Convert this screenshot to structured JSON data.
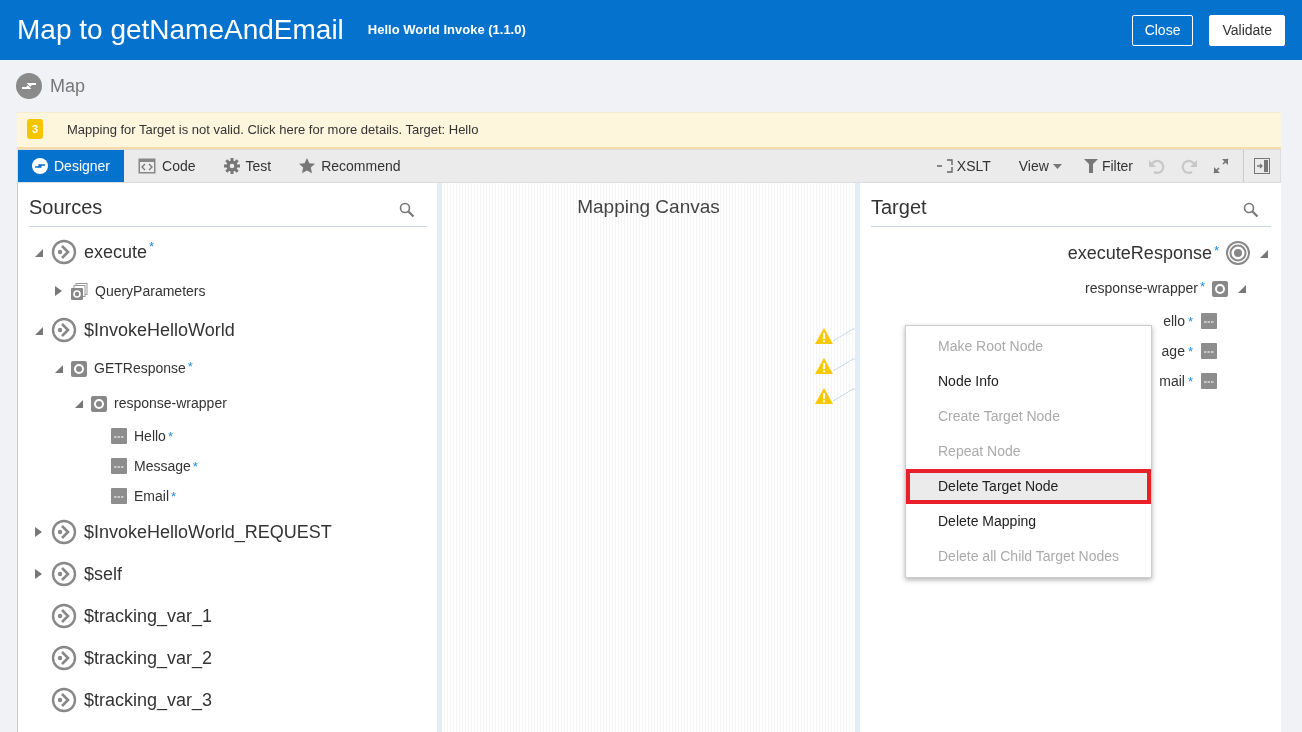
{
  "header": {
    "title": "Map to getNameAndEmail",
    "subtitle": "Hello World Invoke (1.1.0)",
    "buttons": [
      {
        "label": "Close",
        "kind": "outline"
      },
      {
        "label": "Validate",
        "kind": "solid"
      }
    ]
  },
  "page_title": "Map",
  "alert": {
    "count": "3",
    "message": "Mapping for Target is not valid. Click here for more details. Target: Hello"
  },
  "tabs": [
    {
      "label": "Designer",
      "kind": "designer",
      "selected": true
    },
    {
      "label": "Code",
      "kind": "code",
      "selected": false
    },
    {
      "label": "Test",
      "kind": "test",
      "selected": false
    },
    {
      "label": "Recommend",
      "kind": "recommend",
      "selected": false
    }
  ],
  "tools": [
    {
      "kind": "xslt",
      "label": "XSLT",
      "disabled": false
    },
    {
      "kind": "view",
      "label": "View",
      "disabled": false
    },
    {
      "kind": "filter",
      "label": "Filter",
      "disabled": false
    },
    {
      "kind": "undo",
      "disabled": true
    },
    {
      "kind": "redo",
      "disabled": true
    },
    {
      "kind": "expand",
      "disabled": false
    },
    {
      "kind": "panel",
      "disabled": false
    }
  ],
  "sources": {
    "title": "Sources",
    "tree": [
      {
        "label": "execute",
        "kind": "variable",
        "required_mark": "*",
        "expanded": true,
        "children": [
          {
            "label": "QueryParameters",
            "kind": "collection",
            "expanded": false
          }
        ]
      },
      {
        "label": "$InvokeHelloWorld",
        "kind": "variable",
        "expanded": true,
        "children": [
          {
            "label": "GETResponse",
            "kind": "element",
            "required_mark": "*",
            "expanded": true,
            "children": [
              {
                "label": "response-wrapper",
                "kind": "element",
                "expanded": true,
                "children": [
                  {
                    "label": "Hello",
                    "kind": "text",
                    "required_mark": "*"
                  },
                  {
                    "label": "Message",
                    "kind": "text",
                    "required_mark": "*"
                  },
                  {
                    "label": "Email",
                    "kind": "text",
                    "required_mark": "*"
                  }
                ]
              }
            ]
          }
        ]
      },
      {
        "label": "$InvokeHelloWorld_REQUEST",
        "kind": "variable",
        "expanded": false
      },
      {
        "label": "$self",
        "kind": "variable",
        "expanded": false
      },
      {
        "label": "$tracking_var_1",
        "kind": "variable"
      },
      {
        "label": "$tracking_var_2",
        "kind": "variable"
      },
      {
        "label": "$tracking_var_3",
        "kind": "variable"
      }
    ]
  },
  "canvas": {
    "title": "Mapping Canvas"
  },
  "target": {
    "title": "Target",
    "tree": [
      {
        "label": "executeResponse",
        "kind": "root",
        "required_mark": "*",
        "expanded": true,
        "children": [
          {
            "label": "response-wrapper",
            "kind": "element",
            "required_mark": "*",
            "expanded": true,
            "children": [
              {
                "label": "ello",
                "kind": "text",
                "required_mark": "*",
                "warning": true
              },
              {
                "label": "age",
                "kind": "text",
                "required_mark": "*",
                "warning": true
              },
              {
                "label": "mail",
                "kind": "text",
                "required_mark": "*",
                "warning": true
              }
            ]
          }
        ]
      }
    ]
  },
  "context_menu": {
    "items": [
      {
        "label": "Make Root Node",
        "disabled": true,
        "selected": false
      },
      {
        "label": "Node Info",
        "disabled": false,
        "selected": false
      },
      {
        "label": "Create Target Node",
        "disabled": true,
        "selected": false
      },
      {
        "label": "Repeat Node",
        "disabled": true,
        "selected": false
      },
      {
        "label": "Delete Target Node",
        "disabled": false,
        "selected": true
      },
      {
        "label": "Delete Mapping",
        "disabled": false,
        "selected": false
      },
      {
        "label": "Delete all Child Target Nodes",
        "disabled": true,
        "selected": false
      }
    ]
  }
}
